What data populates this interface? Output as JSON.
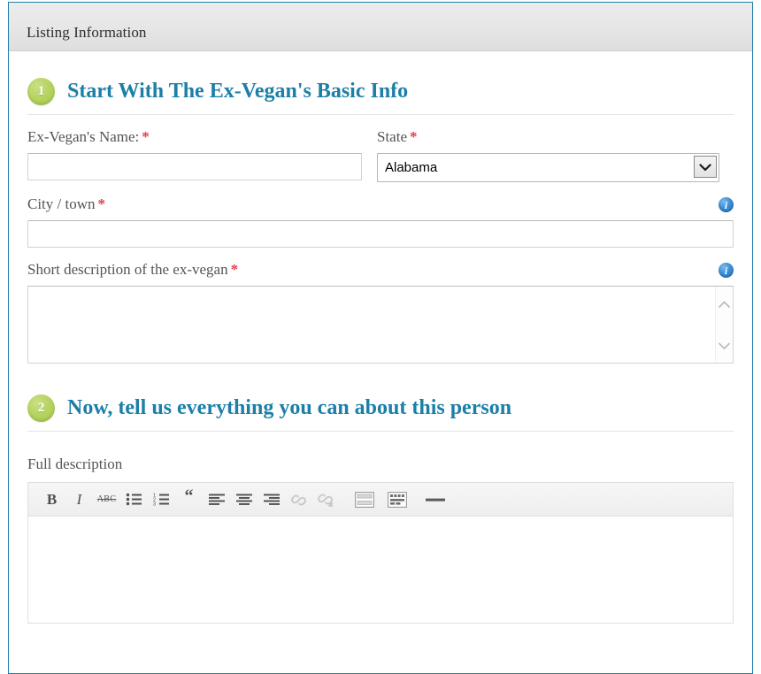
{
  "panel": {
    "header_title": "Listing Information"
  },
  "sections": [
    {
      "number": "1",
      "title": "Start With The Ex-Vegan's Basic Info"
    },
    {
      "number": "2",
      "title": "Now, tell us everything you can about this person"
    }
  ],
  "fields": {
    "name": {
      "label": "Ex-Vegan's Name:",
      "required_marker": "*",
      "value": "",
      "placeholder": ""
    },
    "state": {
      "label": "State",
      "required_marker": "*",
      "selected": "Alabama",
      "options": [
        "Alabama"
      ]
    },
    "city": {
      "label": "City / town",
      "required_marker": "*",
      "value": "",
      "placeholder": "",
      "info_glyph": "i"
    },
    "short_description": {
      "label": "Short description of the ex-vegan",
      "required_marker": "*",
      "value": "",
      "placeholder": "",
      "info_glyph": "i"
    },
    "full_description": {
      "label": "Full description",
      "value": ""
    }
  },
  "editor_toolbar": {
    "buttons": [
      {
        "name": "bold",
        "glyph": "B"
      },
      {
        "name": "italic",
        "glyph": "I"
      },
      {
        "name": "strikethrough",
        "glyph": "ABC"
      },
      {
        "name": "bullet-list",
        "glyph": ""
      },
      {
        "name": "numbered-list",
        "glyph": ""
      },
      {
        "name": "blockquote",
        "glyph": "“"
      },
      {
        "name": "align-left",
        "glyph": ""
      },
      {
        "name": "align-center",
        "glyph": ""
      },
      {
        "name": "align-right",
        "glyph": ""
      },
      {
        "name": "insert-link",
        "glyph": ""
      },
      {
        "name": "unlink",
        "glyph": ""
      },
      {
        "name": "insert-more-tag",
        "glyph": ""
      },
      {
        "name": "toggle-toolbar",
        "glyph": ""
      },
      {
        "name": "horizontal-rule",
        "glyph": ""
      }
    ]
  },
  "colors": {
    "panel_border": "#1e7ea8",
    "heading_blue": "#1b7fa8",
    "badge_green": "#b5d45f",
    "required_red": "#e0414d",
    "label_gray": "#555555",
    "info_blue": "#3b8fd6"
  }
}
